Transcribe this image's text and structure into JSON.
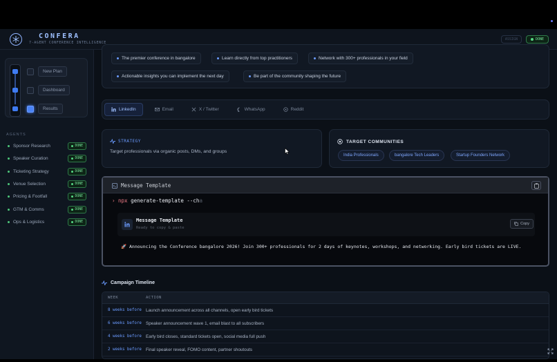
{
  "app": {
    "brand_name": "CONFERA",
    "brand_sub": "7-AGENT CONFERENCE INTELLIGENCE",
    "status_ghost": "ASSIGN",
    "status_done": "DONE"
  },
  "steps": [
    {
      "label": "New Plan",
      "checked": false
    },
    {
      "label": "Dashboard",
      "checked": false
    },
    {
      "label": "Results",
      "checked": true
    }
  ],
  "agents_heading": "AGENTS",
  "agents": [
    {
      "name": "Sponsor Research",
      "status": "DONE"
    },
    {
      "name": "Speaker Curation",
      "status": "DONE"
    },
    {
      "name": "Ticketing Strategy",
      "status": "DONE"
    },
    {
      "name": "Venue Selection",
      "status": "DONE"
    },
    {
      "name": "Pricing & Footfall",
      "status": "DONE"
    },
    {
      "name": "GTM & Comms",
      "status": "DONE"
    },
    {
      "name": "Ops & Logistics",
      "status": "DONE"
    }
  ],
  "highlights": [
    "The premier conference in bangalore",
    "Learn directly from top practitioners",
    "Network with 300+ professionals in your field",
    "Actionable insights you can implement the next day",
    "Be part of the community shaping the future"
  ],
  "channels": [
    {
      "label": "LinkedIn",
      "icon": "linkedin-icon",
      "active": true
    },
    {
      "label": "Email",
      "icon": "mail-icon",
      "active": false
    },
    {
      "label": "X / Twitter",
      "icon": "x-icon",
      "active": false
    },
    {
      "label": "WhatsApp",
      "icon": "chat-icon",
      "active": false
    },
    {
      "label": "Reddit",
      "icon": "reddit-icon",
      "active": false
    }
  ],
  "strategy": {
    "heading": "STRATEGY",
    "text": "Target professionals via organic posts, DMs, and groups"
  },
  "communities": {
    "heading": "TARGET COMMUNITIES",
    "items": [
      "India Professionals",
      "bangalore Tech Leaders",
      "Startup Founders Network"
    ]
  },
  "terminal": {
    "title": "Message Template",
    "prompt": "›",
    "cmd_pm": "npx",
    "cmd_rest": "generate-template --ch",
    "caret": "a",
    "card_title": "Message Template",
    "card_sub": "Ready to copy & paste",
    "copy_label": "Copy",
    "message": "🚀 Announcing the  Conference bangalore 2026! Join 300+ professionals for 2 days of keynotes, workshops, and networking. Early bird tickets are LIVE."
  },
  "timeline": {
    "heading": "Campaign Timeline",
    "columns": [
      "WEEK",
      "ACTION"
    ],
    "rows": [
      {
        "week": "8 weeks before",
        "action": "Launch announcement across all channels, open early bird tickets"
      },
      {
        "week": "6 weeks before",
        "action": "Speaker announcement wave 1, email blast to all subscribers"
      },
      {
        "week": "4 weeks before",
        "action": "Early bird closes, standard tickets open, social media full push"
      },
      {
        "week": "2 weeks before",
        "action": "Final speaker reveal, FOMO content, partner shoutouts"
      }
    ]
  },
  "colors": {
    "accent": "#6b9bff",
    "done": "#76e39a",
    "background": "#0b1017"
  }
}
